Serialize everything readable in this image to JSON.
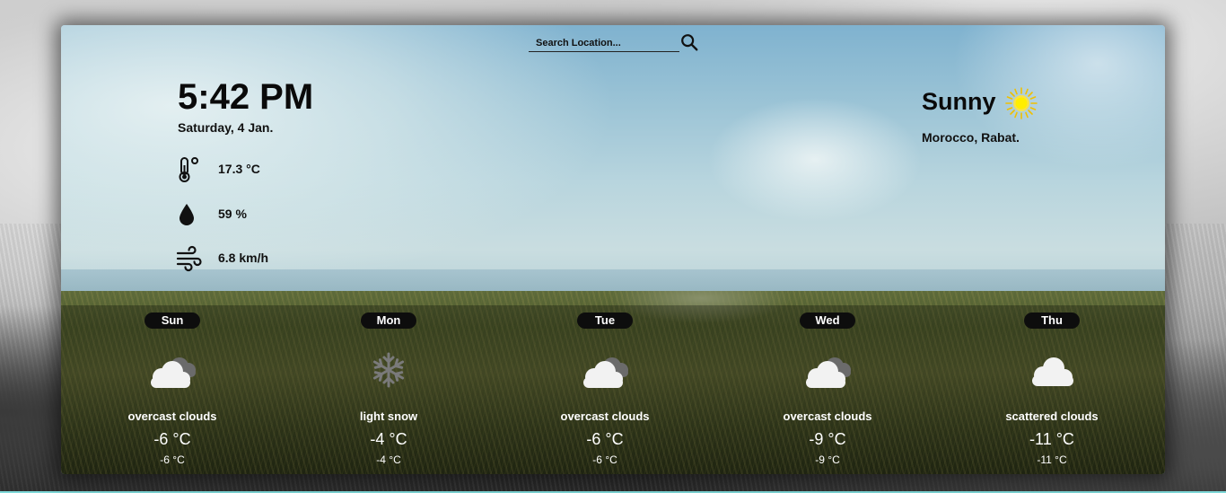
{
  "search": {
    "placeholder": "Search Location..."
  },
  "current": {
    "time": "5:42 PM",
    "date": "Saturday, 4 Jan.",
    "temperature": "17.3 °C",
    "humidity": "59 %",
    "wind": "6.8 km/h",
    "condition": "Sunny",
    "location": "Morocco, Rabat."
  },
  "forecast": [
    {
      "day": "Sun",
      "icon": "overcast-clouds-icon",
      "description": "overcast clouds",
      "temp": "-6 °C",
      "low": "-6 °C"
    },
    {
      "day": "Mon",
      "icon": "snowflake-icon",
      "description": "light snow",
      "temp": "-4 °C",
      "low": "-4 °C"
    },
    {
      "day": "Tue",
      "icon": "overcast-clouds-icon",
      "description": "overcast clouds",
      "temp": "-6 °C",
      "low": "-6 °C"
    },
    {
      "day": "Wed",
      "icon": "overcast-clouds-icon",
      "description": "overcast clouds",
      "temp": "-9 °C",
      "low": "-9 °C"
    },
    {
      "day": "Thu",
      "icon": "scattered-clouds-icon",
      "description": "scattered clouds",
      "temp": "-11 °C",
      "low": "-11 °C"
    }
  ],
  "colors": {
    "sun": "#f5d000",
    "accent_line": "#7fd8d8"
  }
}
